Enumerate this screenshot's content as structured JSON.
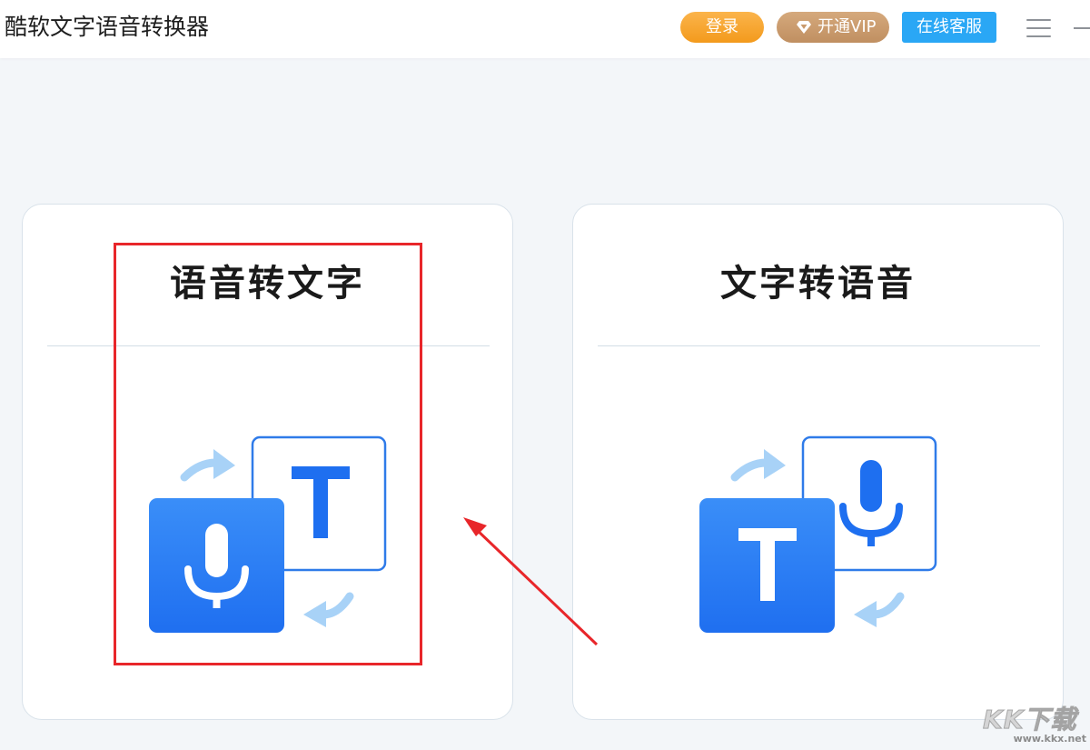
{
  "app": {
    "title": "酷软文字语音转换器"
  },
  "header": {
    "login_label": "登录",
    "vip_label": "开通VIP",
    "service_label": "在线客服",
    "menu_icon": "hamburger-menu-icon",
    "minimize_icon": "minimize-icon"
  },
  "cards": [
    {
      "title": "语音转文字",
      "icon": "speech-to-text-icon",
      "highlighted": true
    },
    {
      "title": "文字转语音",
      "icon": "text-to-speech-icon",
      "highlighted": false
    }
  ],
  "watermark": {
    "logo": "KK下载",
    "url": "www.kkx.net"
  },
  "colors": {
    "login": "#f5a42c",
    "vip": "#c99a6c",
    "service": "#2aa7f5",
    "icon_blue": "#1e6ff0",
    "icon_light_blue": "#a8d2f7",
    "annotation_red": "#e8262a"
  }
}
